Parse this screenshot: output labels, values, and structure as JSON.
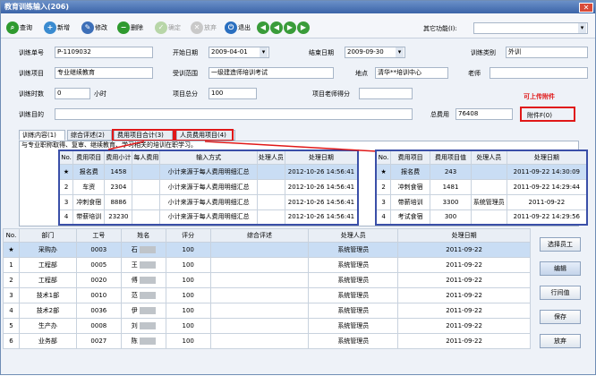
{
  "window": {
    "title": "教育训练输入(206)",
    "close": "✕"
  },
  "toolbar": {
    "query": "查询",
    "add": "新增",
    "edit": "修改",
    "delete": "删除",
    "confirm": "确定",
    "discard": "放弃",
    "exit": "退出",
    "nav": [
      "◀",
      "◀",
      "▶",
      "▶"
    ],
    "other_label": "其它功能(I):"
  },
  "form": {
    "train_no_label": "训练单号",
    "train_no": "P-1109032",
    "start_label": "开始日期",
    "start": "2009-04-01",
    "end_label": "结束日期",
    "end": "2009-09-30",
    "category_label": "训练类别",
    "category": "外训",
    "item_label": "训练项目",
    "item": "专业继续教育",
    "scope_label": "受训范围",
    "scope": "一级建造师培训考试",
    "place_label": "地点",
    "place": "清华**培训中心",
    "teacher_label": "老师",
    "teacher": "",
    "hours_label": "训练时数",
    "hours": "0",
    "hours_unit": "小时",
    "total_label": "项目总分",
    "total": "100",
    "teacher_score_label": "项目老师得分",
    "teacher_score": "",
    "purpose_label": "训练目的",
    "purpose": "",
    "cost_label": "总费用",
    "cost": "76408",
    "attach_note": "可上传附件",
    "attach_btn": "附件F(0)"
  },
  "tabs": [
    "训练内容(1)",
    "综合评述(2)",
    "费用项目合计(3)",
    "人员费用项目(4)"
  ],
  "content_text": "与专业职称取得、复审、继续教育、学习相关的培训在职学习。",
  "cost_sum": {
    "headers": [
      "No.",
      "费用项目",
      "费用小计",
      "每人费用",
      "输入方式",
      "处理人员",
      "处理日期"
    ],
    "rows": [
      [
        "★",
        "报名费",
        "1458",
        "",
        "小计来源于每人费用明细汇总",
        "",
        "2012-10-26 14:56:41"
      ],
      [
        "2",
        "车资",
        "2304",
        "",
        "小计来源于每人费用明细汇总",
        "",
        "2012-10-26 14:56:41"
      ],
      [
        "3",
        "冲刺食宿",
        "8886",
        "",
        "小计来源于每人费用明细汇总",
        "",
        "2012-10-26 14:56:41"
      ],
      [
        "4",
        "带薪培训",
        "23230",
        "",
        "小计来源于每人费用明细汇总",
        "",
        "2012-10-26 14:56:41"
      ]
    ]
  },
  "person_cost": {
    "headers": [
      "No.",
      "费用项目",
      "费用项目值",
      "处理人员",
      "处理日期"
    ],
    "rows": [
      [
        "★",
        "报名费",
        "243",
        "",
        "2011-09-22 14:30:09"
      ],
      [
        "2",
        "冲刺食宿",
        "1481",
        "",
        "2011-09-22 14:29:44"
      ],
      [
        "3",
        "带薪培训",
        "3300",
        "系统管理员",
        "2011-09-22"
      ],
      [
        "4",
        "考试食宿",
        "300",
        "",
        "2011-09-22 14:29:56"
      ]
    ]
  },
  "staff": {
    "headers": [
      "No.",
      "部门",
      "工号",
      "姓名",
      "评分",
      "综合评述",
      "处理人员",
      "处理日期"
    ],
    "rows": [
      [
        "★",
        "采购办",
        "0003",
        "石",
        "100",
        "",
        "系统管理员",
        "2011-09-22"
      ],
      [
        "1",
        "工程部",
        "0005",
        "王",
        "100",
        "",
        "系统管理员",
        "2011-09-22"
      ],
      [
        "2",
        "工程部",
        "0020",
        "傅",
        "100",
        "",
        "系统管理员",
        "2011-09-22"
      ],
      [
        "3",
        "技术1部",
        "0010",
        "范",
        "100",
        "",
        "系统管理员",
        "2011-09-22"
      ],
      [
        "4",
        "技术2部",
        "0036",
        "伊",
        "100",
        "",
        "系统管理员",
        "2011-09-22"
      ],
      [
        "5",
        "生产办",
        "0008",
        "刘",
        "100",
        "",
        "系统管理员",
        "2011-09-22"
      ],
      [
        "6",
        "业务部",
        "0027",
        "陈",
        "100",
        "",
        "系统管理员",
        "2011-09-22"
      ]
    ]
  },
  "side_buttons": [
    "选择员工",
    "编辑",
    "行间值",
    "保存",
    "放弃"
  ]
}
